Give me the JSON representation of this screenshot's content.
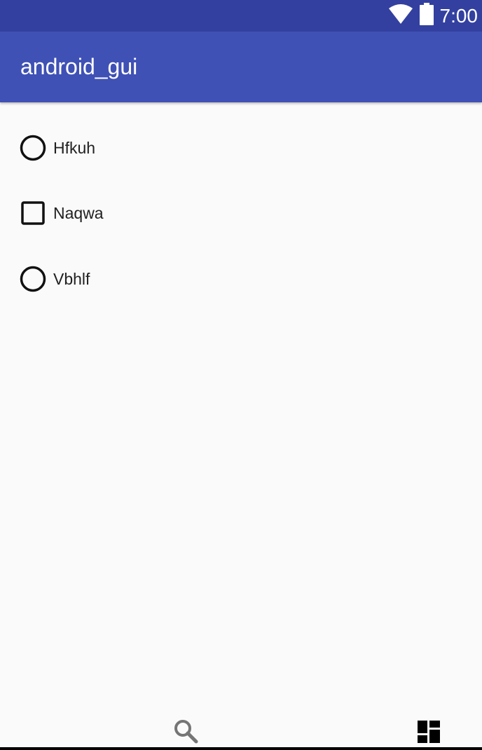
{
  "status_bar": {
    "time": "7:00",
    "icons": [
      "wifi-icon",
      "battery-icon"
    ],
    "color": "#3340a0"
  },
  "app_bar": {
    "title": "android_gui",
    "color": "#3f51b5"
  },
  "options": [
    {
      "type": "radio",
      "label": "Hfkuh",
      "checked": false
    },
    {
      "type": "checkbox",
      "label": "Naqwa",
      "checked": false
    },
    {
      "type": "radio",
      "label": "Vbhlf",
      "checked": false
    }
  ],
  "bottom_nav": {
    "items": [
      "search-icon",
      "dashboard-icon"
    ]
  }
}
